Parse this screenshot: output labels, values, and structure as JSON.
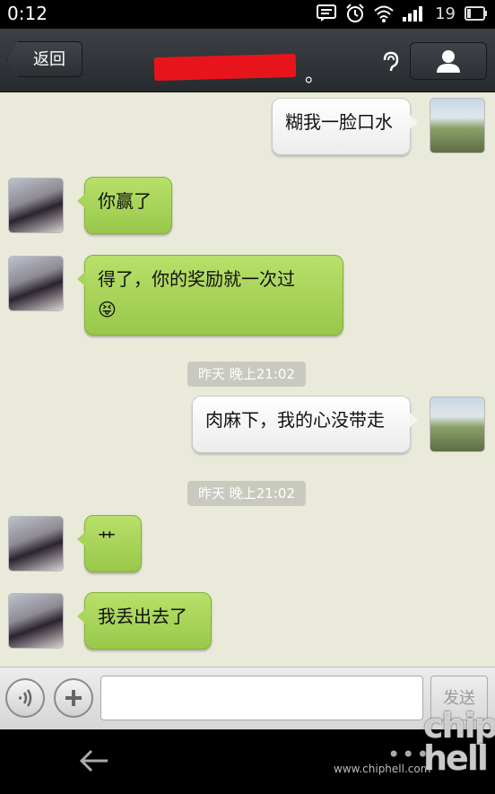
{
  "status_bar": {
    "time": "0:12",
    "battery": "19"
  },
  "header": {
    "back_label": "返回",
    "title_suffix": "。"
  },
  "messages": [
    {
      "side": "right",
      "text": "糊我一脸口水"
    },
    {
      "side": "left",
      "text": "你赢了"
    },
    {
      "side": "left",
      "text": "得了，你的奖励就一次过",
      "emoji": "😝"
    },
    {
      "side": "right",
      "text": "肉麻下，我的心没带走"
    },
    {
      "side": "left",
      "text": "艹"
    },
    {
      "side": "left",
      "text": "我丢出去了"
    }
  ],
  "timestamps": [
    "昨天 晚上21:02",
    "昨天 晚上21:02"
  ],
  "input_bar": {
    "send_label": "发送"
  },
  "watermark": {
    "url": "www.chiphell.com",
    "logo": "chip hell"
  },
  "colors": {
    "left_bubble": "#a8d45a",
    "right_bubble": "#f4f4f4",
    "chat_bg": "#eaeadb",
    "redaction": "#e8141c"
  }
}
